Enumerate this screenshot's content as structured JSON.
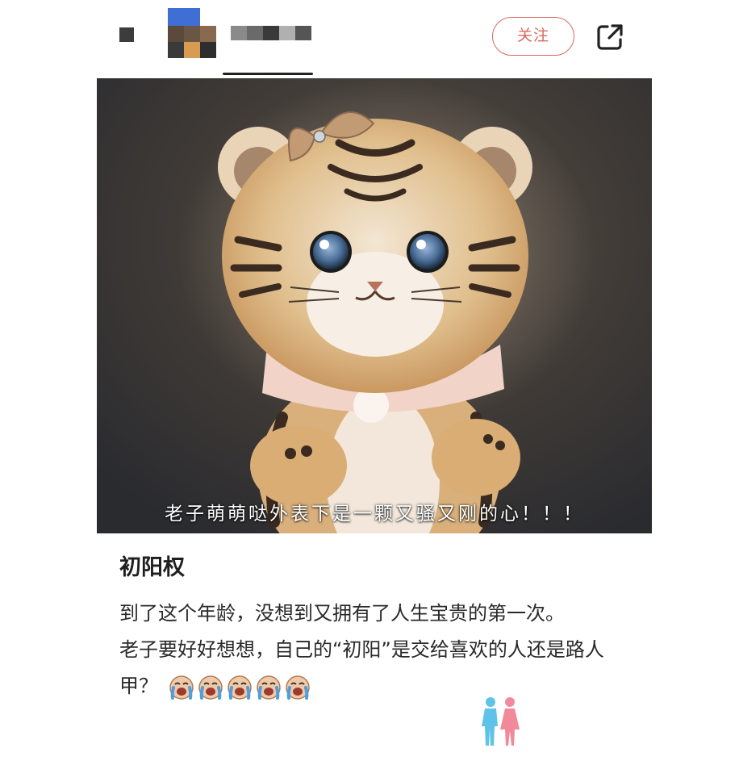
{
  "header": {
    "follow_label": "关注",
    "share_icon": "external-share-icon"
  },
  "image": {
    "caption": "老子萌萌哒外表下是一颗又骚又刚的心！！！"
  },
  "post": {
    "title": "初阳权",
    "line1": "到了这个年龄，没想到又拥有了人生宝贵的第一次。",
    "line2": "老子要好好想想，自己的“初阳”是交给喜欢的人还是路人甲？",
    "emoji_icons": [
      "crying-face-icon",
      "crying-face-icon",
      "crying-face-icon",
      "crying-face-icon",
      "crying-face-icon"
    ]
  },
  "colors": {
    "follow_accent": "#d9685e",
    "text": "#2a2a2a"
  }
}
